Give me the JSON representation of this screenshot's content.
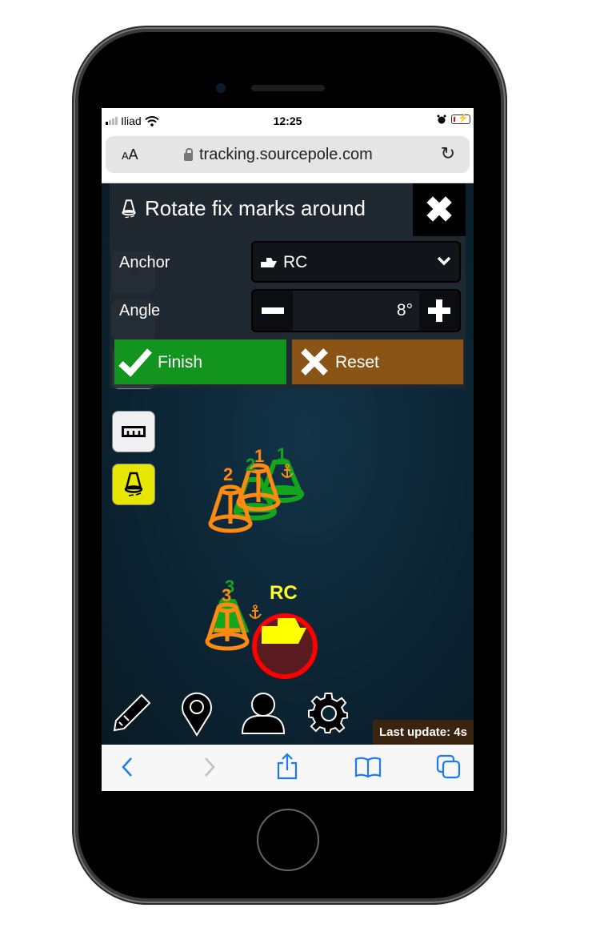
{
  "status_bar": {
    "carrier": "Iliad",
    "time": "12:25"
  },
  "browser": {
    "text_size_label": "AA",
    "url": "tracking.sourcepole.com",
    "toolbar_icons": [
      "back-icon",
      "forward-icon",
      "share-icon",
      "bookmarks-icon",
      "tabs-icon"
    ]
  },
  "panel": {
    "title": "Rotate fix marks around",
    "anchor_label": "Anchor",
    "anchor_value": "RC",
    "angle_label": "Angle",
    "angle_value": "8°",
    "finish_label": "Finish",
    "reset_label": "Reset"
  },
  "map": {
    "marks": [
      {
        "label": "2",
        "color": "orange"
      },
      {
        "label": "2",
        "color": "green"
      },
      {
        "label": "1",
        "color": "orange"
      },
      {
        "label": "1",
        "color": "green"
      },
      {
        "label": "3",
        "color": "green"
      },
      {
        "label": "3",
        "color": "orange"
      }
    ],
    "boat_label": "RC",
    "last_update": "Last update: 4s"
  },
  "colors": {
    "finish": "#13941f",
    "reset": "#8b5417",
    "mark_orange": "#ff8a12",
    "mark_green": "#14a51c",
    "boat": "#ffff00",
    "boat_ring": "#ff0000",
    "tool_active": "#e6e600"
  }
}
